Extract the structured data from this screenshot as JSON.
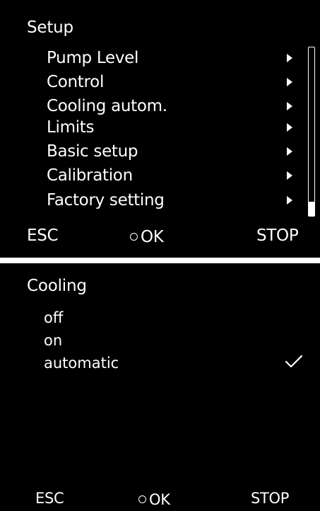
{
  "setup": {
    "title": "Setup",
    "items": [
      {
        "label": "Pump Level"
      },
      {
        "label": "Control"
      },
      {
        "label": "Cooling autom."
      },
      {
        "label": "Limits"
      },
      {
        "label": "Basic setup"
      },
      {
        "label": "Calibration"
      },
      {
        "label": "Factory setting"
      }
    ],
    "softkeys": {
      "esc": "ESC",
      "ok": "OK",
      "stop": "STOP"
    }
  },
  "cooling": {
    "title": "Cooling",
    "options": [
      {
        "label": "off",
        "selected": false
      },
      {
        "label": "on",
        "selected": false
      },
      {
        "label": "automatic",
        "selected": true
      }
    ],
    "softkeys": {
      "esc": "ESC",
      "ok": "OK",
      "stop": "STOP"
    }
  },
  "colors": {
    "background": "#000000",
    "text": "#ffffff",
    "divider": "#ffffff"
  },
  "icons": {
    "submenu": "chevron-right-icon",
    "selected": "checkmark-icon",
    "ok": "ring-icon"
  }
}
